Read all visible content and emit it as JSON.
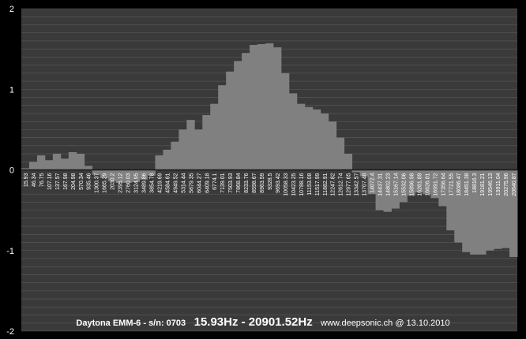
{
  "colors": {
    "background": "#000000",
    "plot_area": "#3a3a3a",
    "gridline": "#5a5a5a",
    "fill": "#808080",
    "text": "#ffffff"
  },
  "footer": {
    "model": "Daytona EMM-6 - s/n: 0703",
    "range": "15.93Hz - 20901.52Hz",
    "site": "www.deepsonic.ch @ 13.10.2010"
  },
  "chart_data": {
    "type": "area",
    "title": "",
    "xlabel": "",
    "ylabel": "",
    "ylim": [
      -2,
      2
    ],
    "yticks": [
      -2,
      -1,
      0,
      1,
      2
    ],
    "grid": true,
    "legend": "none",
    "categories": [
      "15.93",
      "46.34",
      "76.75",
      "107.16",
      "137.57",
      "167.98",
      "204.98",
      "570.34",
      "935.46",
      "1300.37",
      "1665.29",
      "2030.2",
      "2395.12",
      "2760.03",
      "3124.95",
      "3489.86",
      "3854.78",
      "4219.69",
      "4584.61",
      "4949.52",
      "5314.44",
      "5679.35",
      "6044.27",
      "6409.18",
      "6774.1",
      "7139.01",
      "7503.93",
      "7868.84",
      "8233.76",
      "8598.67",
      "8963.59",
      "9328.5",
      "9693.42",
      "10058.33",
      "10423.25",
      "10788.16",
      "11153.08",
      "11517.99",
      "11882.91",
      "12247.82",
      "12612.74",
      "12977.65",
      "13342.57",
      "13707.48",
      "14072.4",
      "14437.31",
      "14802.23",
      "15167.14",
      "15532.06",
      "15896.98",
      "16261.89",
      "16626.81",
      "16991.72",
      "17356.64",
      "17721.55",
      "18086.47",
      "18451.38",
      "18816.3",
      "19181.21",
      "19546.13",
      "19911.04",
      "20275.96",
      "20640.87"
    ],
    "values": [
      0.02,
      0.1,
      0.18,
      0.12,
      0.2,
      0.14,
      0.22,
      0.2,
      0.05,
      -0.06,
      -0.1,
      -0.14,
      -0.16,
      -0.16,
      -0.15,
      -0.12,
      -0.07,
      0.18,
      0.25,
      0.35,
      0.5,
      0.62,
      0.5,
      0.68,
      0.82,
      1.05,
      1.22,
      1.35,
      1.45,
      1.55,
      1.56,
      1.57,
      1.52,
      1.2,
      0.95,
      0.82,
      0.78,
      0.75,
      0.7,
      0.6,
      0.4,
      0.2,
      -0.03,
      -0.08,
      -0.3,
      -0.5,
      -0.52,
      -0.48,
      -0.4,
      -0.32,
      -0.28,
      -0.3,
      -0.35,
      -0.45,
      -0.75,
      -0.9,
      -1.02,
      -1.05,
      -1.05,
      -1.0,
      -0.98,
      -0.97,
      -1.08
    ]
  }
}
